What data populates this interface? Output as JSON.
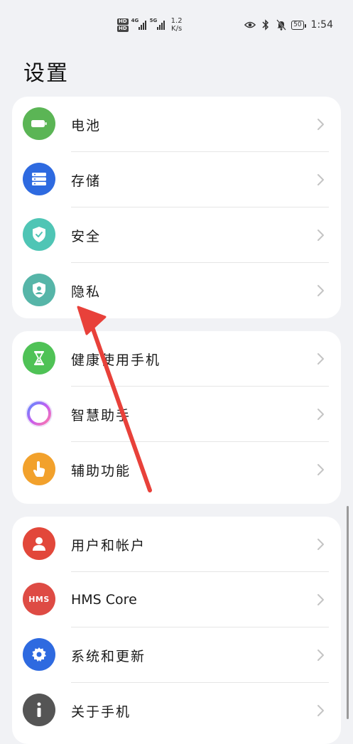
{
  "status_bar": {
    "hd_top": "HD",
    "hd_bottom": "HD",
    "signal_1_label": "4G",
    "signal_2_label": "5G",
    "speed_value": "1.2",
    "speed_unit": "K/s",
    "battery": "50",
    "time": "1:54",
    "icons": [
      "eye-icon",
      "bluetooth-icon",
      "mute-bell-icon"
    ]
  },
  "page_title": "设置",
  "groups": [
    {
      "items": [
        {
          "label": "电池",
          "icon": "battery-icon",
          "color": "#5bb555"
        },
        {
          "label": "存储",
          "icon": "storage-icon",
          "color": "#2e6ae0"
        },
        {
          "label": "安全",
          "icon": "shield-icon",
          "color": "#4fc5b5"
        },
        {
          "label": "隐私",
          "icon": "privacy-icon",
          "color": "#56b5a8"
        }
      ]
    },
    {
      "items": [
        {
          "label": "健康使用手机",
          "icon": "hourglass-icon",
          "color": "#4fc256"
        },
        {
          "label": "智慧助手",
          "icon": "assistant-ring-icon",
          "color": "#c06af0"
        },
        {
          "label": "辅助功能",
          "icon": "hand-icon",
          "color": "#f2a12c"
        }
      ]
    },
    {
      "items": [
        {
          "label": "用户和帐户",
          "icon": "user-icon",
          "color": "#e2473a"
        },
        {
          "label": "HMS Core",
          "icon": "hms-icon",
          "color": "#de4b44",
          "badge": "HMS"
        },
        {
          "label": "系统和更新",
          "icon": "gear-icon",
          "color": "#2e6ae0"
        },
        {
          "label": "关于手机",
          "icon": "info-icon",
          "color": "#555555"
        }
      ]
    }
  ],
  "annotation": {
    "type": "red-arrow",
    "color": "#e8413a"
  }
}
